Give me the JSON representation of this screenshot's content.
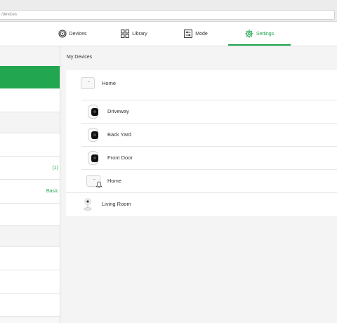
{
  "browser": {
    "url": "/devices"
  },
  "nav": {
    "devices": "Devices",
    "library": "Library",
    "mode": "Mode",
    "settings": "Settings"
  },
  "colors": {
    "accent": "#22a650",
    "text": "#333333",
    "divider": "#e6e6e6"
  },
  "sidebar": {
    "account_value": "(1)",
    "plan_value": "Basic"
  },
  "main": {
    "title": "My Devices",
    "devices": [
      {
        "name": "Home",
        "icon": "base-station-icon"
      },
      {
        "name": "Driveway",
        "icon": "camera-icon"
      },
      {
        "name": "Back Yard",
        "icon": "camera-icon"
      },
      {
        "name": "Front Door",
        "icon": "camera-icon"
      },
      {
        "name": "Home",
        "icon": "base-station-siren-icon"
      },
      {
        "name": "Living Room",
        "icon": "indoor-camera-icon"
      }
    ]
  }
}
